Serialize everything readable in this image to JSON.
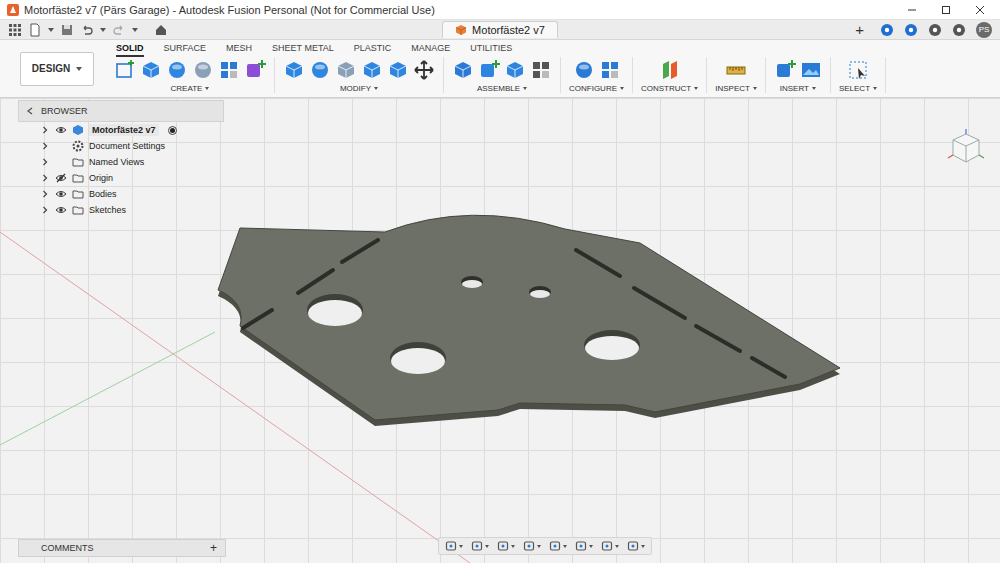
{
  "window": {
    "title": "Motorfäste2 v7 (Pärs Garage) - Autodesk Fusion Personal (Not for Commercial Use)"
  },
  "app_bar": {
    "document_tab": {
      "title": "Motorfäste2 v7",
      "selected": true
    },
    "new_tab": "+",
    "user_initials": "PS"
  },
  "workspace": {
    "label": "DESIGN"
  },
  "tabs": [
    {
      "label": "SOLID",
      "selected": true
    },
    {
      "label": "SURFACE",
      "selected": false
    },
    {
      "label": "MESH",
      "selected": false
    },
    {
      "label": "SHEET METAL",
      "selected": false
    },
    {
      "label": "PLASTIC",
      "selected": false
    },
    {
      "label": "MANAGE",
      "selected": false
    },
    {
      "label": "UTILITIES",
      "selected": false
    }
  ],
  "groups": [
    {
      "label": "CREATE"
    },
    {
      "label": "MODIFY"
    },
    {
      "label": "ASSEMBLE"
    },
    {
      "label": "CONFIGURE"
    },
    {
      "label": "CONSTRUCT"
    },
    {
      "label": "INSPECT"
    },
    {
      "label": "INSERT"
    },
    {
      "label": "SELECT"
    }
  ],
  "browser": {
    "title": "BROWSER",
    "items": [
      {
        "label": "Motorfäste2 v7",
        "kind": "component",
        "visible": true,
        "expanded": false,
        "active": true
      },
      {
        "label": "Document Settings",
        "kind": "settings",
        "expanded": false
      },
      {
        "label": "Named Views",
        "kind": "folder",
        "expanded": false
      },
      {
        "label": "Origin",
        "kind": "folder",
        "visible": false,
        "expanded": false
      },
      {
        "label": "Bodies",
        "kind": "folder",
        "visible": true,
        "expanded": false
      },
      {
        "label": "Sketches",
        "kind": "folder",
        "visible": true,
        "expanded": false
      }
    ]
  },
  "comments": {
    "title": "COMMENTS",
    "add": "+"
  }
}
